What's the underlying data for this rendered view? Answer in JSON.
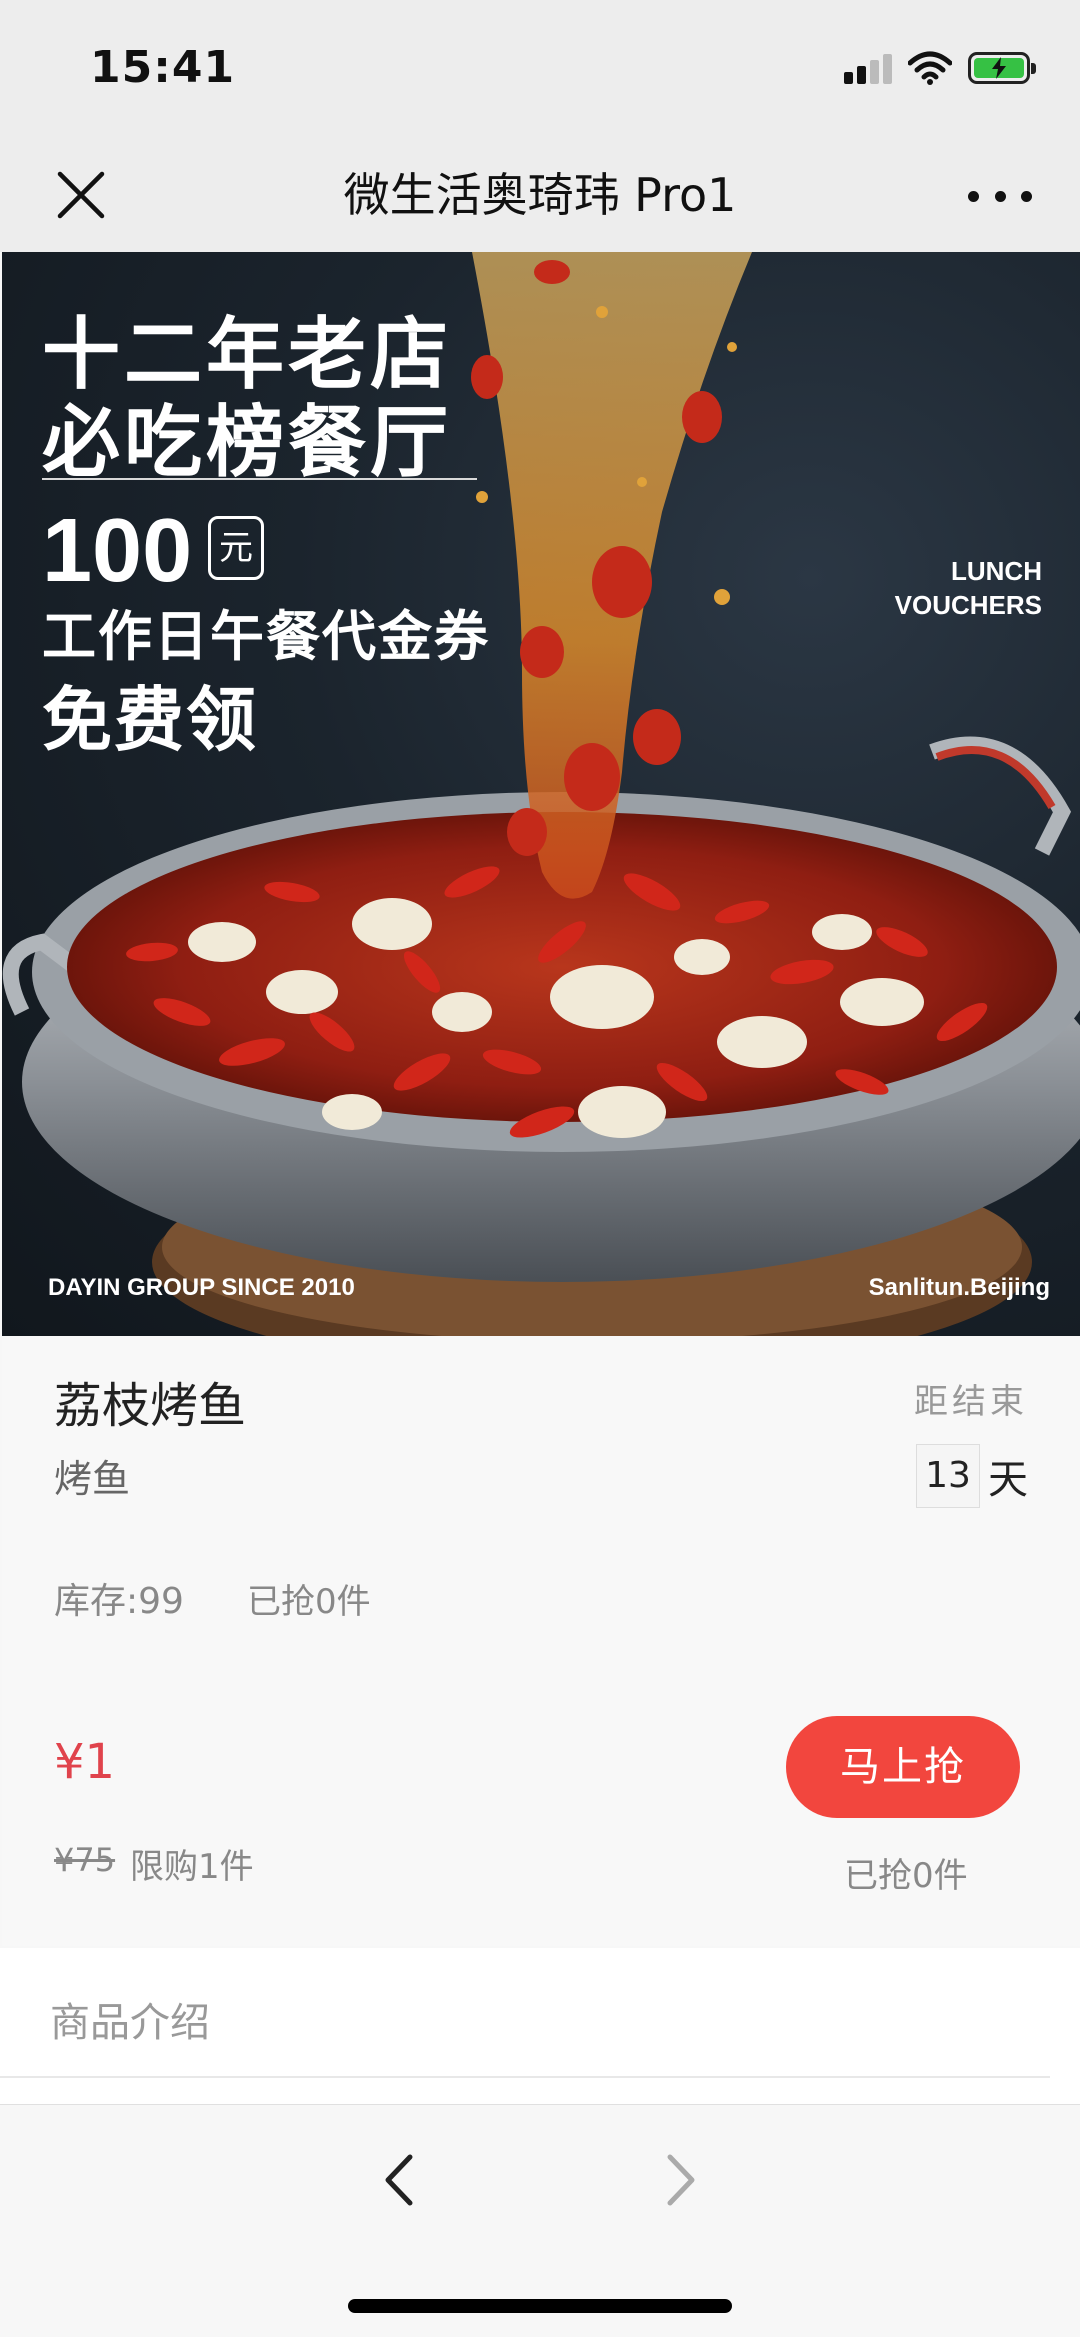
{
  "status_bar": {
    "time": "15:41"
  },
  "nav": {
    "title": "微生活奥琦玮 Pro1"
  },
  "hero": {
    "line1": "十二年老店",
    "line2": "必吃榜餐厅",
    "amount": "100",
    "amount_unit": "元",
    "line4": "工作日午餐代金券",
    "line5": "免费领",
    "lunch_line1": "LUNCH",
    "lunch_line2": "VOUCHERS",
    "brand": "DAYIN GROUP SINCE 2010",
    "location": "Sanlitun.Beijing"
  },
  "product": {
    "name": "荔枝烤鱼",
    "category": "烤鱼",
    "countdown_label": "距结束",
    "countdown_days": "13",
    "countdown_unit": "天",
    "stock": "库存:99",
    "grabbed_count_top": "已抢0件",
    "price": "¥1",
    "original_price": "¥75",
    "limit": "限购1件",
    "buy_button": "马上抢",
    "grabbed_count_bottom": "已抢0件"
  },
  "intro": {
    "label": "商品介绍"
  },
  "colors": {
    "accent": "#f2463e",
    "price": "#e0434c",
    "battery": "#36c144"
  }
}
